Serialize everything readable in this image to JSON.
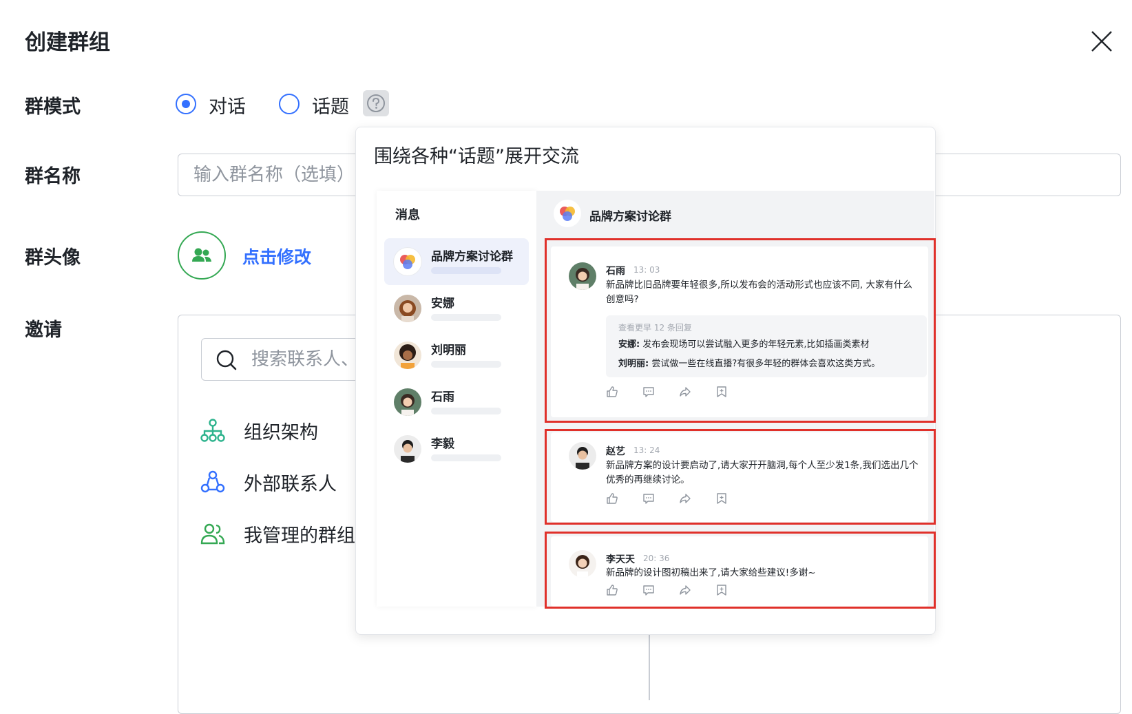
{
  "dialog": {
    "title": "创建群组",
    "close_icon": "close-icon"
  },
  "group_mode": {
    "label": "群模式",
    "options": [
      {
        "label": "对话",
        "selected": true
      },
      {
        "label": "话题",
        "selected": false
      }
    ],
    "help_icon": "question-circle-icon"
  },
  "group_name": {
    "label": "群名称",
    "placeholder": "输入群名称（选填）",
    "value": ""
  },
  "group_avatar": {
    "label": "群头像",
    "avatar_icon": "group-users-icon",
    "change_link": "点击修改"
  },
  "invite": {
    "label": "邀请",
    "search_placeholder": "搜索联系人、",
    "categories": [
      {
        "label": "组织架构",
        "icon": "org-chart-icon"
      },
      {
        "label": "外部联系人",
        "icon": "external-contacts-icon"
      },
      {
        "label": "我管理的群组",
        "icon": "managed-groups-icon"
      }
    ]
  },
  "tooltip": {
    "title": "围绕各种“话题”展开交流",
    "preview": {
      "sidebar_title": "消息",
      "chat_title": "品牌方案讨论群",
      "conversations": [
        {
          "name": "品牌方案讨论群",
          "active": true
        },
        {
          "name": "安娜",
          "active": false
        },
        {
          "name": "刘明丽",
          "active": false
        },
        {
          "name": "石雨",
          "active": false
        },
        {
          "name": "李毅",
          "active": false
        }
      ],
      "messages": [
        {
          "author": "石雨",
          "time": "13: 03",
          "text_lines": [
            "新品牌比旧品牌要年轻很多,所以发布会的活动形式也应该不同, 大家有什么",
            "创意吗?"
          ],
          "replies_more": "查看更早 12 条回复",
          "replies": [
            {
              "author": "安娜:",
              "text": "发布会现场可以尝试融入更多的年轻元素,比如插画类素材"
            },
            {
              "author": "刘明丽:",
              "text": "尝试做一些在线直播?有很多年轻的群体会喜欢这类方式。"
            }
          ]
        },
        {
          "author": "赵艺",
          "time": "13: 24",
          "text_lines": [
            "新品牌方案的设计要启动了,请大家开开脑洞,每个人至少发1条,我们选出几个",
            "优秀的再继续讨论。"
          ]
        },
        {
          "author": "李天天",
          "time": "20: 36",
          "text_lines": [
            "新品牌的设计图初稿出来了,请大家给些建议!多谢~"
          ]
        }
      ],
      "action_icons": [
        "thumbs-up-icon",
        "comment-icon",
        "forward-icon",
        "bookmark-icon"
      ]
    }
  },
  "colors": {
    "primary": "#3370ff",
    "avatar_green": "#34a853",
    "highlight_red": "#e0302a"
  }
}
